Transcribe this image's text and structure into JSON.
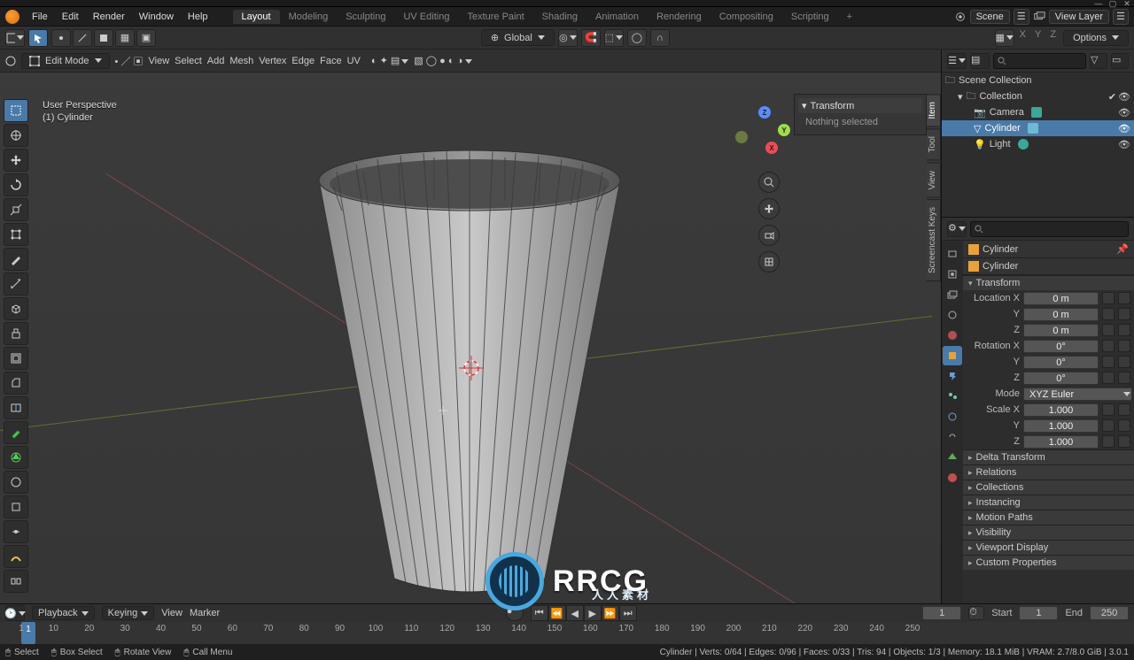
{
  "window": {
    "title": "Blender"
  },
  "topmenu": [
    "File",
    "Edit",
    "Render",
    "Window",
    "Help"
  ],
  "workspaces": [
    "Layout",
    "Modeling",
    "Sculpting",
    "UV Editing",
    "Texture Paint",
    "Shading",
    "Animation",
    "Rendering",
    "Compositing",
    "Scripting",
    "+"
  ],
  "active_workspace": "Layout",
  "scene": {
    "label": "Scene",
    "layer": "View Layer"
  },
  "hdr2": {
    "orientation": "Global",
    "options": "Options"
  },
  "viewport": {
    "mode": "Edit Mode",
    "menus": [
      "View",
      "Select",
      "Add",
      "Mesh",
      "Vertex",
      "Edge",
      "Face",
      "UV"
    ],
    "info_line1": "User Perspective",
    "info_line2": "(1) Cylinder"
  },
  "npanel": {
    "tabs": [
      "Item",
      "Tool",
      "View",
      "Screencast Keys"
    ],
    "active": "Item",
    "panel_title": "Transform",
    "panel_body": "Nothing selected"
  },
  "tools": [
    "select-box",
    "cursor",
    "move",
    "rotate",
    "scale",
    "transform",
    "annotate",
    "measure",
    "add-cube",
    "extrude",
    "inset",
    "bevel",
    "loop-cut",
    "knife",
    "poly-build",
    "spin",
    "smooth",
    "edge-slide",
    "shrink",
    "rip",
    "rip-fill"
  ],
  "outliner": {
    "root": "Scene Collection",
    "items": [
      {
        "name": "Collection",
        "depth": 1,
        "icon": "collection"
      },
      {
        "name": "Camera",
        "depth": 2,
        "icon": "camera"
      },
      {
        "name": "Cylinder",
        "depth": 2,
        "icon": "mesh",
        "selected": true
      },
      {
        "name": "Light",
        "depth": 2,
        "icon": "light"
      }
    ]
  },
  "properties": {
    "crumb": [
      "Cylinder"
    ],
    "datablock": "Cylinder",
    "transform": {
      "title": "Transform",
      "loc_label": "Location X",
      "rot_label": "Rotation X",
      "scale_label": "Scale X",
      "mode_label": "Mode",
      "loc": [
        "0 m",
        "0 m",
        "0 m"
      ],
      "rot": [
        "0°",
        "0°",
        "0°"
      ],
      "rot_mode": "XYZ Euler",
      "scale": [
        "1.000",
        "1.000",
        "1.000"
      ]
    },
    "sections": [
      "Delta Transform",
      "Relations",
      "Collections",
      "Instancing",
      "Motion Paths",
      "Visibility",
      "Viewport Display",
      "Custom Properties"
    ]
  },
  "prop_tabs": [
    "render",
    "output",
    "view-layer",
    "scene",
    "world",
    "object",
    "modifiers",
    "particles",
    "physics",
    "constraints",
    "data",
    "material",
    "texture"
  ],
  "active_prop_tab": "object",
  "timeline": {
    "menus": [
      "Playback",
      "Keying",
      "View",
      "Marker"
    ],
    "current": 1,
    "start_label": "Start",
    "start": 1,
    "end_label": "End",
    "end": 250,
    "ticks": [
      1,
      10,
      20,
      30,
      40,
      50,
      60,
      70,
      80,
      90,
      100,
      110,
      120,
      130,
      140,
      150,
      160,
      170,
      180,
      190,
      200,
      210,
      220,
      230,
      240,
      250
    ]
  },
  "status": {
    "select": "Select",
    "box": "Box Select",
    "rotate": "Rotate View",
    "menu": "Call Menu",
    "right": "Cylinder | Verts: 0/64 | Edges: 0/96 | Faces: 0/33 | Tris: 94 | Objects: 1/3 | Memory: 18.1 MiB | VRAM: 2.7/8.0 GiB | 3.0.1"
  },
  "watermark": {
    "big": "RRCG",
    "sub": "人人素材"
  }
}
